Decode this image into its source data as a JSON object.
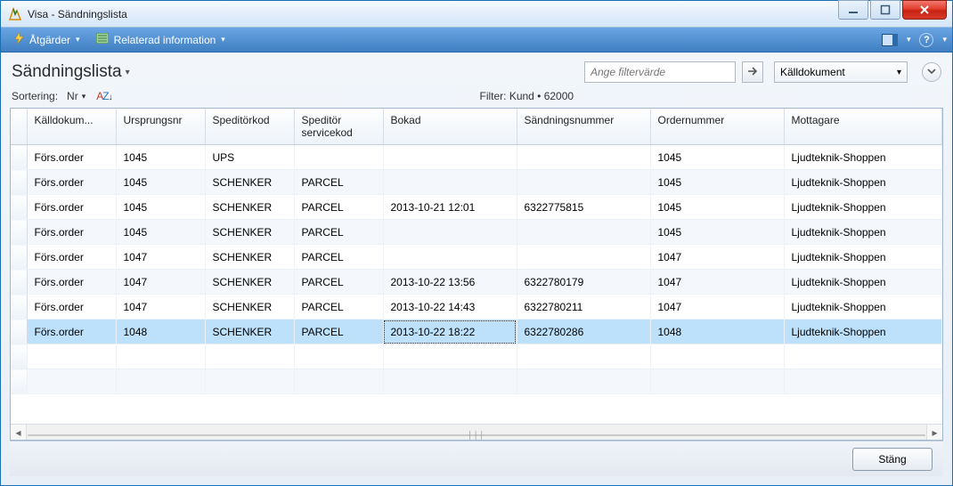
{
  "window": {
    "title": "Visa - Sändningslista"
  },
  "ribbon": {
    "actions_label": "Åtgärder",
    "related_label": "Relaterad information"
  },
  "page": {
    "title": "Sändningslista",
    "filter_placeholder": "Ange filtervärde",
    "filter_field_label": "Källdokument",
    "sort_label": "Sortering:",
    "sort_field": "Nr",
    "filter_summary": "Filter: Kund • 62000"
  },
  "columns": [
    "Källdokum...",
    "Ursprungsnr",
    "Speditörkod",
    "Speditör servicekod",
    "Bokad",
    "Sändningsnummer",
    "Ordernummer",
    "Mottagare"
  ],
  "rows": [
    {
      "doc": "Förs.order",
      "origin": "1045",
      "carrier": "UPS",
      "service": "",
      "booked": "",
      "shipno": "",
      "orderno": "1045",
      "recipient": "Ljudteknik-Shoppen"
    },
    {
      "doc": "Förs.order",
      "origin": "1045",
      "carrier": "SCHENKER",
      "service": "PARCEL",
      "booked": "",
      "shipno": "",
      "orderno": "1045",
      "recipient": "Ljudteknik-Shoppen"
    },
    {
      "doc": "Förs.order",
      "origin": "1045",
      "carrier": "SCHENKER",
      "service": "PARCEL",
      "booked": "2013-10-21 12:01",
      "shipno": "6322775815",
      "orderno": "1045",
      "recipient": "Ljudteknik-Shoppen"
    },
    {
      "doc": "Förs.order",
      "origin": "1045",
      "carrier": "SCHENKER",
      "service": "PARCEL",
      "booked": "",
      "shipno": "",
      "orderno": "1045",
      "recipient": "Ljudteknik-Shoppen"
    },
    {
      "doc": "Förs.order",
      "origin": "1047",
      "carrier": "SCHENKER",
      "service": "PARCEL",
      "booked": "",
      "shipno": "",
      "orderno": "1047",
      "recipient": "Ljudteknik-Shoppen"
    },
    {
      "doc": "Förs.order",
      "origin": "1047",
      "carrier": "SCHENKER",
      "service": "PARCEL",
      "booked": "2013-10-22 13:56",
      "shipno": "6322780179",
      "orderno": "1047",
      "recipient": "Ljudteknik-Shoppen"
    },
    {
      "doc": "Förs.order",
      "origin": "1047",
      "carrier": "SCHENKER",
      "service": "PARCEL",
      "booked": "2013-10-22 14:43",
      "shipno": "6322780211",
      "orderno": "1047",
      "recipient": "Ljudteknik-Shoppen"
    },
    {
      "doc": "Förs.order",
      "origin": "1048",
      "carrier": "SCHENKER",
      "service": "PARCEL",
      "booked": "2013-10-22 18:22",
      "shipno": "6322780286",
      "orderno": "1048",
      "recipient": "Ljudteknik-Shoppen",
      "selected": true
    }
  ],
  "footer": {
    "close_label": "Stäng"
  },
  "colors": {
    "accent": "#3f7fc1",
    "selected_row": "#bde1fb"
  }
}
